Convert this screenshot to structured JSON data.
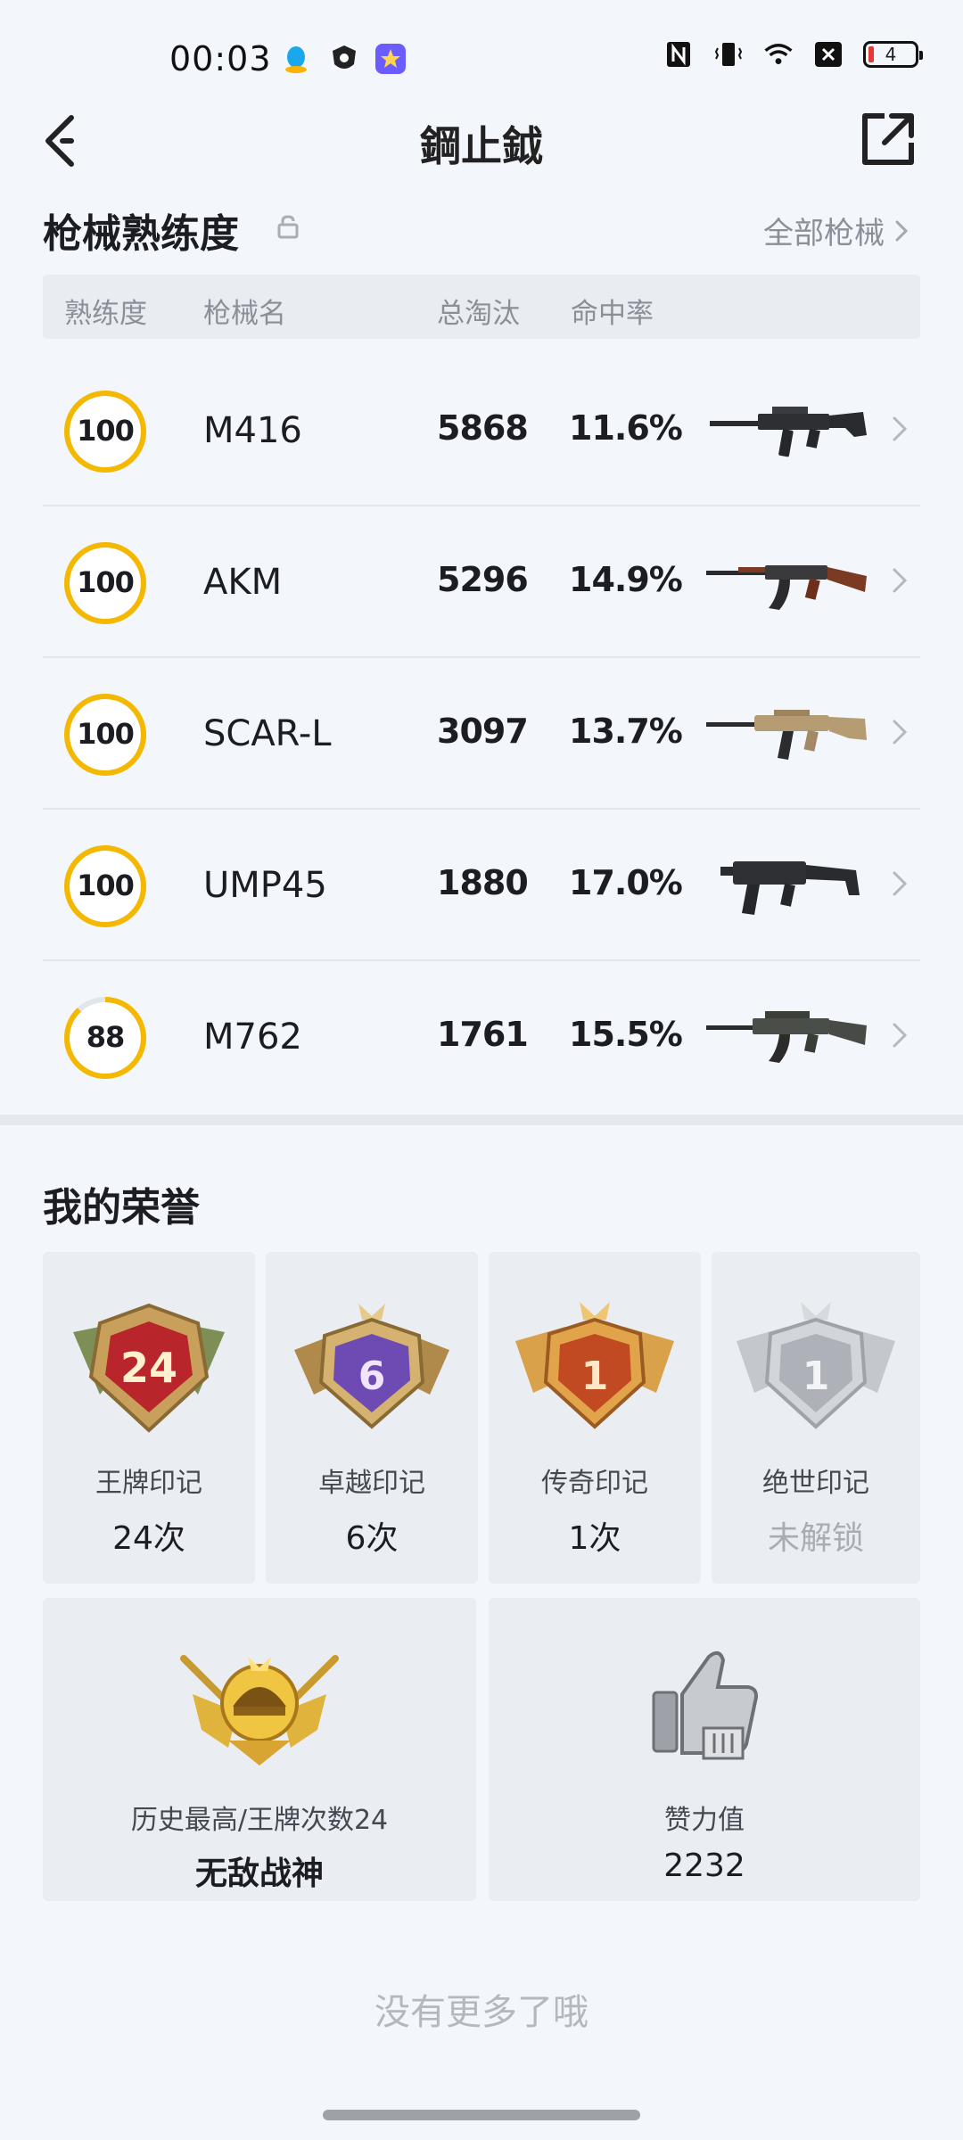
{
  "status_bar": {
    "time": "00:03",
    "battery": "4",
    "icons": [
      "qq-icon",
      "shield-app-icon",
      "star-app-icon",
      "nfc-icon",
      "vibrate-icon",
      "wifi-icon",
      "sim-off-icon",
      "battery-icon"
    ],
    "colors": {
      "battery_low": "#e53935"
    }
  },
  "nav": {
    "title": "鋼止鉞",
    "back_icon": "back-arrow-icon",
    "share_icon": "share-icon"
  },
  "weapons": {
    "title": "枪械熟练度",
    "all_link": "全部枪械",
    "headers": {
      "mastery": "熟练度",
      "name": "枪械名",
      "kills": "总淘汰",
      "accuracy": "命中率"
    },
    "ring_color": "#f5b800",
    "rows": [
      {
        "mastery": "100",
        "mastery_value": 100,
        "name": "M416",
        "kills": "5868",
        "accuracy": "11.6%",
        "gun_icon": "m416-rifle-icon"
      },
      {
        "mastery": "100",
        "mastery_value": 100,
        "name": "AKM",
        "kills": "5296",
        "accuracy": "14.9%",
        "gun_icon": "akm-rifle-icon"
      },
      {
        "mastery": "100",
        "mastery_value": 100,
        "name": "SCAR-L",
        "kills": "3097",
        "accuracy": "13.7%",
        "gun_icon": "scar-rifle-icon"
      },
      {
        "mastery": "100",
        "mastery_value": 100,
        "name": "UMP45",
        "kills": "1880",
        "accuracy": "17.0%",
        "gun_icon": "ump45-smg-icon"
      },
      {
        "mastery": "88",
        "mastery_value": 88,
        "name": "M762",
        "kills": "1761",
        "accuracy": "15.5%",
        "gun_icon": "m762-rifle-icon"
      }
    ]
  },
  "honors": {
    "title": "我的荣誉",
    "marks": [
      {
        "label": "王牌印记",
        "value": "24次",
        "badge_text": "24",
        "badge_icon": "ace-badge-icon"
      },
      {
        "label": "卓越印记",
        "value": "6次",
        "badge_text": "6",
        "badge_icon": "excellence-badge-icon"
      },
      {
        "label": "传奇印记",
        "value": "1次",
        "badge_text": "1",
        "badge_icon": "legend-badge-icon"
      },
      {
        "label": "绝世印记",
        "value": "未解锁",
        "badge_text": "1",
        "badge_icon": "peerless-badge-icon",
        "locked": true
      }
    ],
    "summary": [
      {
        "label": "历史最高/王牌次数24",
        "value": "无敌战神",
        "icon": "conqueror-badge-icon"
      },
      {
        "label": "赞力值",
        "value": "2232",
        "icon": "thumbs-up-icon"
      }
    ]
  },
  "footer": {
    "note": "没有更多了哦"
  }
}
